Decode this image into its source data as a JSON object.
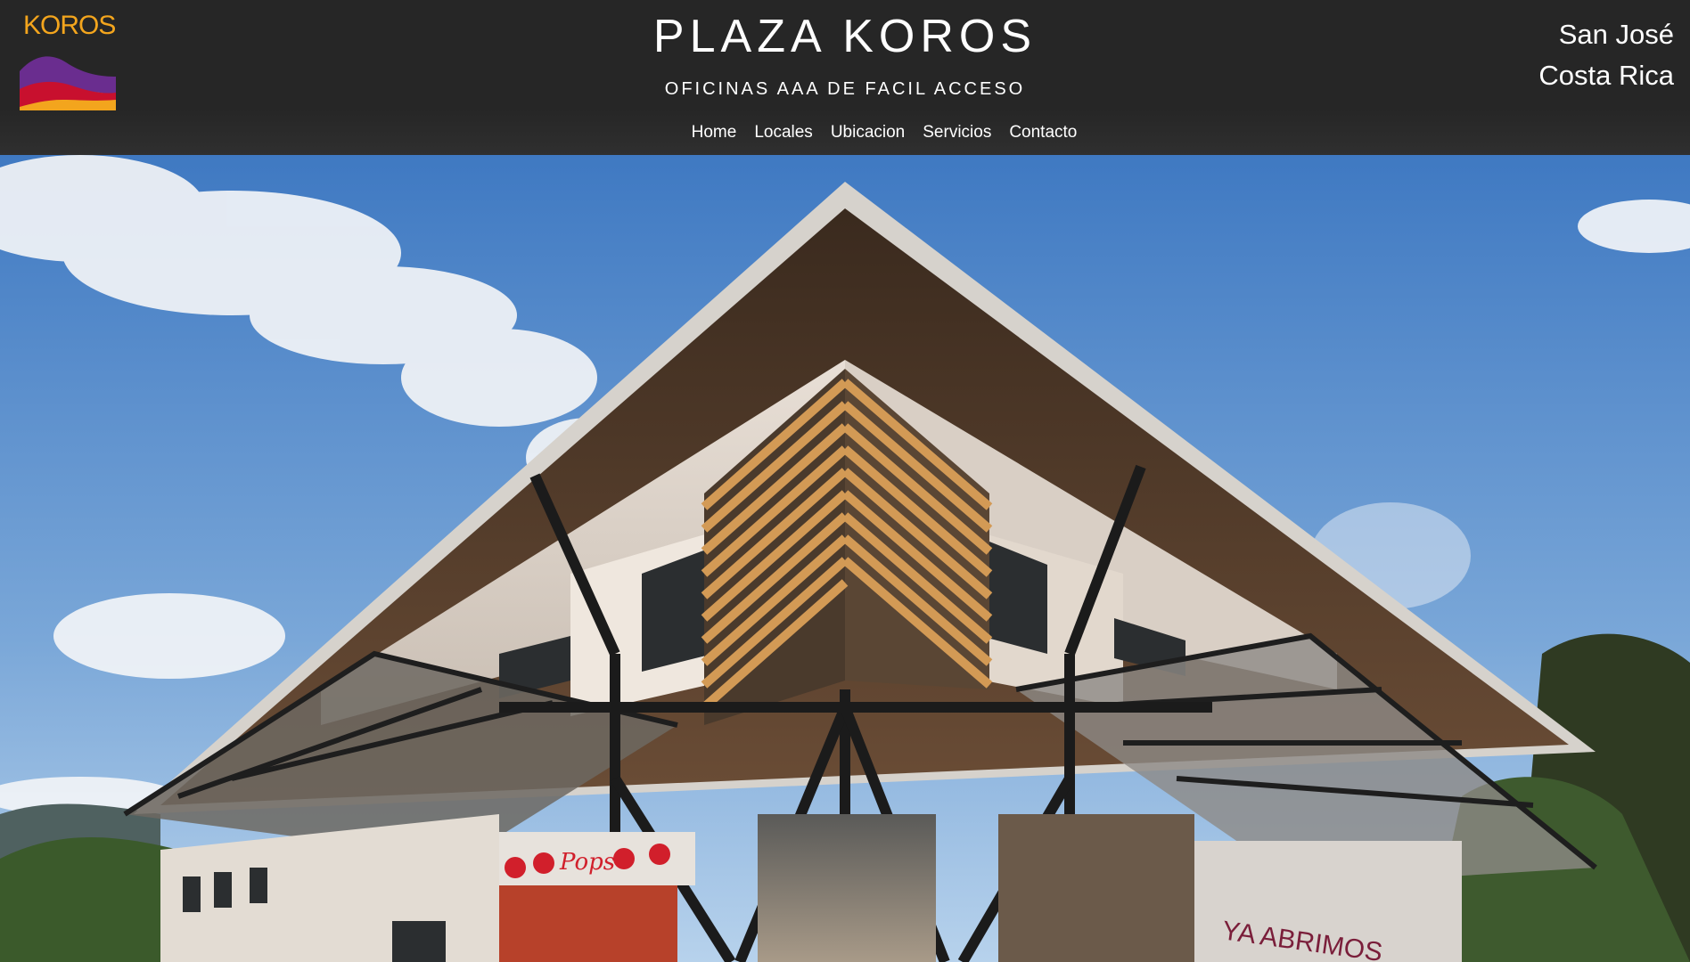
{
  "header": {
    "logo_text": "KOROS",
    "title": "PLAZA KOROS",
    "subtitle": "OFICINAS AAA DE FACIL ACCESO",
    "location_line1": "San José",
    "location_line2": "Costa Rica"
  },
  "nav": {
    "items": [
      {
        "label": "Home"
      },
      {
        "label": "Locales"
      },
      {
        "label": "Ubicacion"
      },
      {
        "label": "Servicios"
      },
      {
        "label": "Contacto"
      }
    ]
  },
  "hero": {
    "storefront_text": "YA ABRIMOS",
    "shop_sign": "Pops"
  },
  "colors": {
    "header_bg": "#262626",
    "logo_orange": "#f3a51d",
    "logo_purple": "#6a2d8f",
    "logo_red": "#c8102e",
    "sky_top": "#3f79c2",
    "sky_bottom": "#a9c9e8"
  }
}
